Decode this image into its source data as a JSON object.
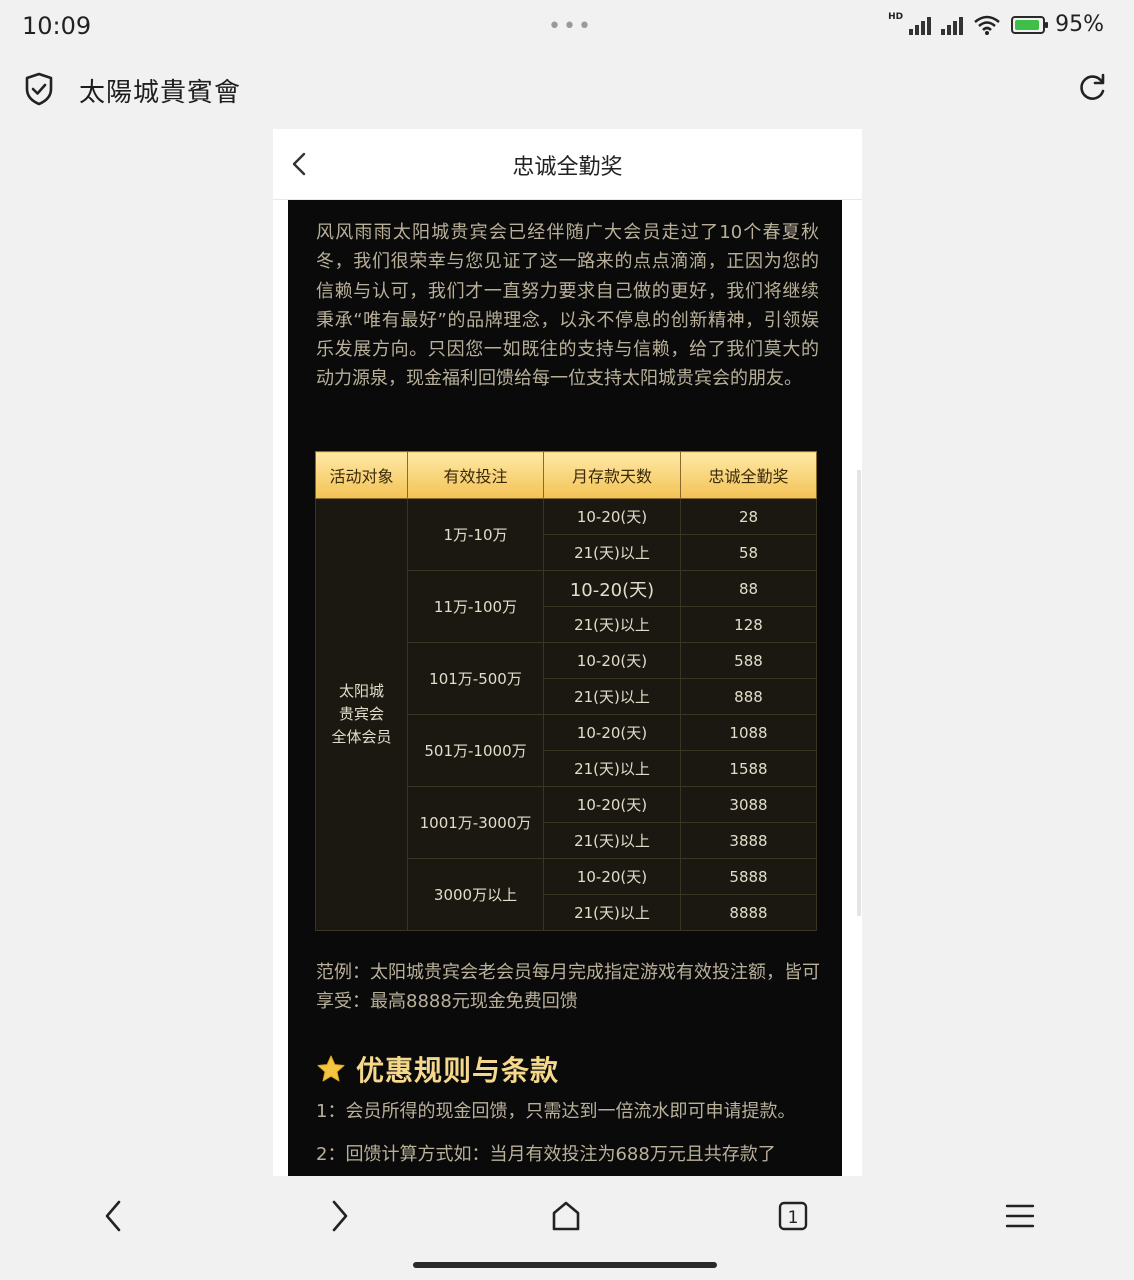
{
  "status_bar": {
    "time": "10:09",
    "battery": "95%",
    "network": "HD"
  },
  "browser": {
    "site_title": "太陽城貴賓會",
    "icons": [
      "shield-check-icon",
      "reload-icon"
    ]
  },
  "page": {
    "title": "忠诚全勤奖",
    "intro": "风风雨雨太阳城贵宾会已经伴随广大会员走过了10个春夏秋冬，我们很荣幸与您见证了这一路来的点点滴滴，正因为您的信赖与认可，我们才一直努力要求自己做的更好，我们将继续秉承“唯有最好”的品牌理念，以永不停息的创新精神，引领娱乐发展方向。只因您一如既往的支持与信赖，给了我们莫大的动力源泉，现金福利回馈给每一位支持太阳城贵宾会的朋友。",
    "table": {
      "headers": [
        "活动对象",
        "有效投注",
        "月存款天数",
        "忠诚全勤奖"
      ],
      "target_lines": [
        "太阳城",
        "贵宾会",
        "全体会员"
      ],
      "tiers": [
        {
          "bet": "1万-10万",
          "rows": [
            {
              "days": "10-20(天)",
              "reward": "28"
            },
            {
              "days": "21(天)以上",
              "reward": "58"
            }
          ]
        },
        {
          "bet": "11万-100万",
          "rows": [
            {
              "days": "10-20(天)",
              "reward": "88"
            },
            {
              "days": "21(天)以上",
              "reward": "128"
            }
          ]
        },
        {
          "bet": "101万-500万",
          "rows": [
            {
              "days": "10-20(天)",
              "reward": "588"
            },
            {
              "days": "21(天)以上",
              "reward": "888"
            }
          ]
        },
        {
          "bet": "501万-1000万",
          "rows": [
            {
              "days": "10-20(天)",
              "reward": "1088"
            },
            {
              "days": "21(天)以上",
              "reward": "1588"
            }
          ]
        },
        {
          "bet": "1001万-3000万",
          "rows": [
            {
              "days": "10-20(天)",
              "reward": "3088"
            },
            {
              "days": "21(天)以上",
              "reward": "3888"
            }
          ]
        },
        {
          "bet": "3000万以上",
          "rows": [
            {
              "days": "10-20(天)",
              "reward": "5888"
            },
            {
              "days": "21(天)以上",
              "reward": "8888"
            }
          ]
        }
      ]
    },
    "example": "范例：太阳城贵宾会老会员每月完成指定游戏有效投注额，皆可享受：最高8888元现金免费回馈",
    "rules_title": "优惠规则与条款",
    "rules": [
      "1：会员所得的现金回馈，只需达到一倍流水即可申请提款。",
      "2：回馈计算方式如：当月有效投注为688万元且共存款了"
    ]
  },
  "bottom_nav": {
    "tab_count": "1",
    "icons": [
      "back-icon",
      "forward-icon",
      "home-icon",
      "tabs-icon",
      "menu-icon"
    ]
  },
  "colors": {
    "content_bg": "#0a0a0a",
    "gold_header": "#f3c256",
    "gold_text": "#f5d88c",
    "body_text": "#b9b09a"
  }
}
